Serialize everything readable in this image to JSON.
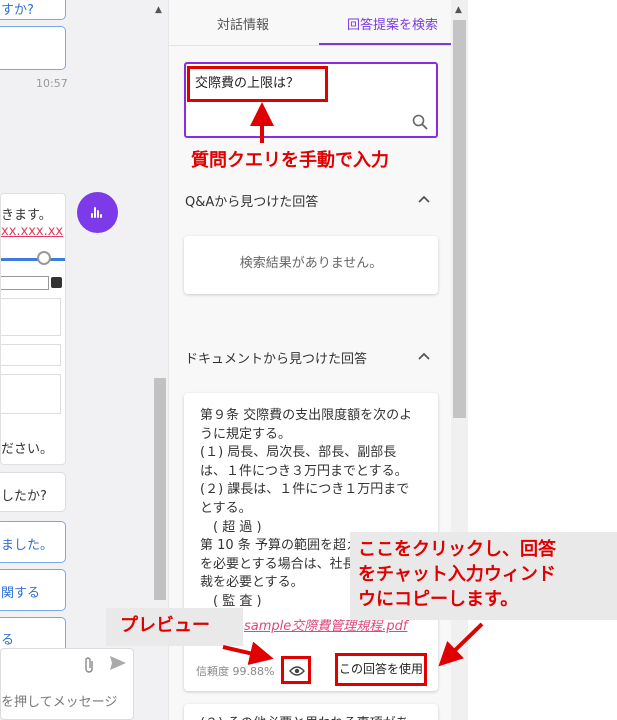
{
  "chat": {
    "top_bubble_fragment": "すか?",
    "timestamp": "10:57",
    "message_text_fragment": "きます。",
    "message_link_fragment": "xx.xxx.xx",
    "bubble_please": "ださい。",
    "bubble_question": "したか?",
    "bubble_done": "ました。",
    "bubble_action": "関する",
    "bubble_ru": "る",
    "input_placeholder": "を押してメッセージ"
  },
  "tabs": {
    "conversation_info": "対話情報",
    "search_answers": "回答提案を検索"
  },
  "search": {
    "query": "交際費の上限は？"
  },
  "qa_section": {
    "title": "Q&Aから見つけた回答",
    "empty_text": "検索結果がありません。"
  },
  "doc_section": {
    "title": "ドキュメントから見つけた回答",
    "lines": [
      "第９条 交際費の支出限度額を次のように規定する。",
      "(１) 局長、局次長、部長、副部長は、１件につき３万円までとする。",
      "(２) 課長は、１件につき１万円までとする。",
      "　( 超 過 )",
      "第 10 条 予算の範囲を超える",
      "を必要とする場合は、社長",
      "裁を必要とする。",
      "　( 監 査 )"
    ],
    "file_name": "sample交際費管理規程.pdf",
    "confidence": "信頼度 99.88%",
    "use_button": "この回答を使用",
    "next_card_fragment": "(２) その他必要と思われる事項があ"
  },
  "annotations": {
    "manual_query": "質問クエリを手動で入力",
    "copy_line1": "ここをクリックし、回答",
    "copy_line2": "をチャット入力ウィンド",
    "copy_line3": "ウにコピーします。",
    "preview": "プレビュー"
  },
  "colors": {
    "accent_purple": "#7a3be0",
    "annotation_red": "#e00000",
    "link_pink": "#e0487a"
  },
  "icons": {
    "search": "magnifier-icon",
    "collapse": "chevron-up-icon",
    "preview": "eye-icon",
    "attach": "paperclip-icon",
    "send": "send-icon",
    "voice": "voice-wave-icon"
  }
}
